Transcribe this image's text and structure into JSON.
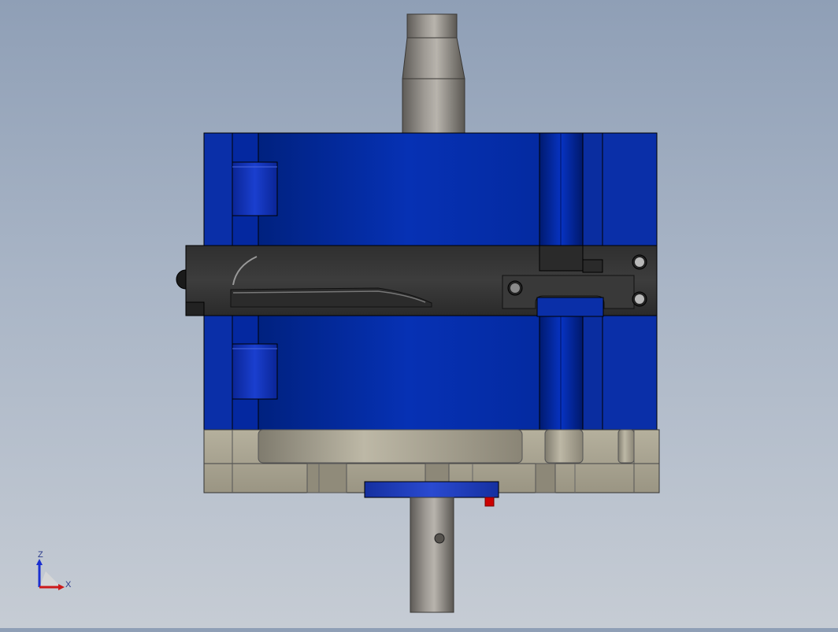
{
  "viewport": {
    "background_top": "#8f9fb6",
    "background_bottom": "#c6ccd4"
  },
  "model": {
    "housing_color": "#0a2fa8",
    "clamp_color": "#3a3a3a",
    "base_color": "#a8a390",
    "shaft_color": "#8a8782",
    "marker_color": "#cc0000"
  },
  "triad": {
    "z_label": "Z",
    "x_label": "X",
    "z_color": "#1a2fd0",
    "x_color": "#cc1a1a"
  }
}
